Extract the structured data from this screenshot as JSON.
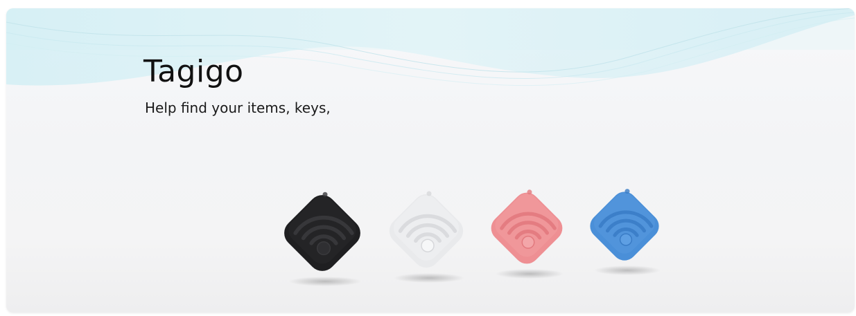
{
  "hero": {
    "title": "Tagigo",
    "tagline": "Help find your items, keys,"
  },
  "products": [
    {
      "name": "black-tracker",
      "color": "#1f1f21",
      "shade": "#2f2f32",
      "ring": "#3a3a3d"
    },
    {
      "name": "white-tracker",
      "color": "#e9eaec",
      "shade": "#f6f7f8",
      "ring": "#d7d8db"
    },
    {
      "name": "pink-tracker",
      "color": "#ee8f93",
      "shade": "#f3a6a9",
      "ring": "#e2797e"
    },
    {
      "name": "blue-tracker",
      "color": "#4a8fd8",
      "shade": "#5e9fe3",
      "ring": "#3a7cc6"
    }
  ],
  "colors": {
    "wave": "#bfe6ef",
    "background": "#f3f4f6"
  }
}
